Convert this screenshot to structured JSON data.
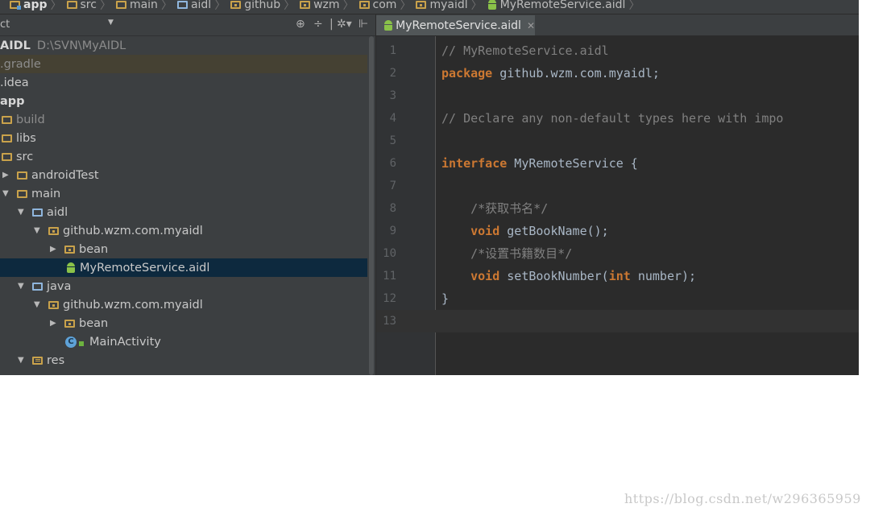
{
  "breadcrumb": [
    "app",
    "src",
    "main",
    "aidl",
    "github",
    "wzm",
    "com",
    "myaidl",
    "MyRemoteService.aidl"
  ],
  "project_panel": {
    "view_label": "ct",
    "tree": [
      {
        "label": "AIDL",
        "extra": "D:\\SVN\\MyAIDL"
      },
      {
        "label": ".gradle"
      },
      {
        "label": ".idea"
      },
      {
        "label": "app"
      },
      {
        "label": "build"
      },
      {
        "label": "libs"
      },
      {
        "label": "src"
      },
      {
        "label": "androidTest"
      },
      {
        "label": "main"
      },
      {
        "label": "aidl"
      },
      {
        "label": "github.wzm.com.myaidl"
      },
      {
        "label": "bean"
      },
      {
        "label": "MyRemoteService.aidl"
      },
      {
        "label": "java"
      },
      {
        "label": "github.wzm.com.myaidl"
      },
      {
        "label": "bean"
      },
      {
        "label": "MainActivity"
      },
      {
        "label": "res"
      }
    ]
  },
  "editor": {
    "tab_title": "MyRemoteService.aidl",
    "lines": [
      {
        "n": "1",
        "parts": [
          {
            "t": "// MyRemoteService.aidl",
            "c": "cm"
          }
        ]
      },
      {
        "n": "2",
        "parts": [
          {
            "t": "package",
            "c": "kw"
          },
          {
            "t": " github.wzm.com.myaidl;",
            "c": ""
          }
        ]
      },
      {
        "n": "3",
        "parts": []
      },
      {
        "n": "4",
        "parts": [
          {
            "t": "// Declare any non-default types here with impo",
            "c": "cm"
          }
        ]
      },
      {
        "n": "5",
        "parts": []
      },
      {
        "n": "6",
        "parts": [
          {
            "t": "interface",
            "c": "kw"
          },
          {
            "t": " MyRemoteService {",
            "c": ""
          }
        ]
      },
      {
        "n": "7",
        "parts": []
      },
      {
        "n": "8",
        "parts": [
          {
            "t": "    /*获取书名*/",
            "c": "cm"
          }
        ]
      },
      {
        "n": "9",
        "parts": [
          {
            "t": "    ",
            "c": ""
          },
          {
            "t": "void",
            "c": "kw"
          },
          {
            "t": " getBookName();",
            "c": ""
          }
        ]
      },
      {
        "n": "10",
        "parts": [
          {
            "t": "    /*设置书籍数目*/",
            "c": "cm"
          }
        ]
      },
      {
        "n": "11",
        "parts": [
          {
            "t": "    ",
            "c": ""
          },
          {
            "t": "void",
            "c": "kw"
          },
          {
            "t": " setBookNumber(",
            "c": ""
          },
          {
            "t": "int",
            "c": "kw"
          },
          {
            "t": " number);",
            "c": ""
          }
        ]
      },
      {
        "n": "12",
        "parts": [
          {
            "t": "}",
            "c": ""
          }
        ]
      },
      {
        "n": "13",
        "parts": []
      }
    ]
  },
  "watermark": "https://blog.csdn.net/w296365959"
}
